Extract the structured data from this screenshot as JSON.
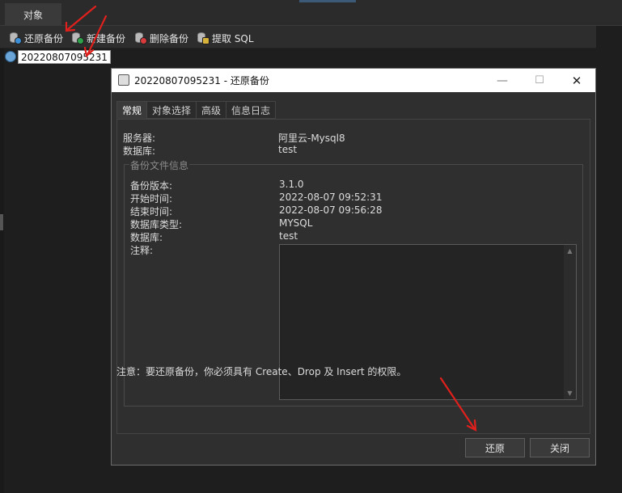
{
  "tabs": {
    "object_tab": "对象"
  },
  "toolbar": {
    "restore_backup": "还原备份",
    "new_backup": "新建备份",
    "delete_backup": "删除备份",
    "extract_sql": "提取 SQL"
  },
  "tree": {
    "selected_item": "20220807095231"
  },
  "dialog": {
    "title": "20220807095231 - 还原备份",
    "window_controls": {
      "minimize": "—",
      "maximize": "☐",
      "close": "✕"
    },
    "tabs": [
      "常规",
      "对象选择",
      "高级",
      "信息日志"
    ],
    "active_tab": "常规",
    "general": {
      "server_label": "服务器:",
      "server_value": "阿里云-Mysql8",
      "database_label": "数据库:",
      "database_value": "test",
      "group_title": "备份文件信息",
      "backup_version_label": "备份版本:",
      "backup_version_value": "3.1.0",
      "start_time_label": "开始时间:",
      "start_time_value": "2022-08-07 09:52:31",
      "end_time_label": "结束时间:",
      "end_time_value": "2022-08-07 09:56:28",
      "db_type_label": "数据库类型:",
      "db_type_value": "MYSQL",
      "db_label": "数据库:",
      "db_value": "test",
      "comment_label": "注释:",
      "comment_value": ""
    },
    "notice": "注意：要还原备份，你必须具有 Create、Drop 及 Insert 的权限。",
    "buttons": {
      "restore": "还原",
      "close": "关闭"
    }
  },
  "colors": {
    "annotation_arrow": "#e0201c",
    "background": "#1e1e1e",
    "titlebar": "#ffffff"
  }
}
